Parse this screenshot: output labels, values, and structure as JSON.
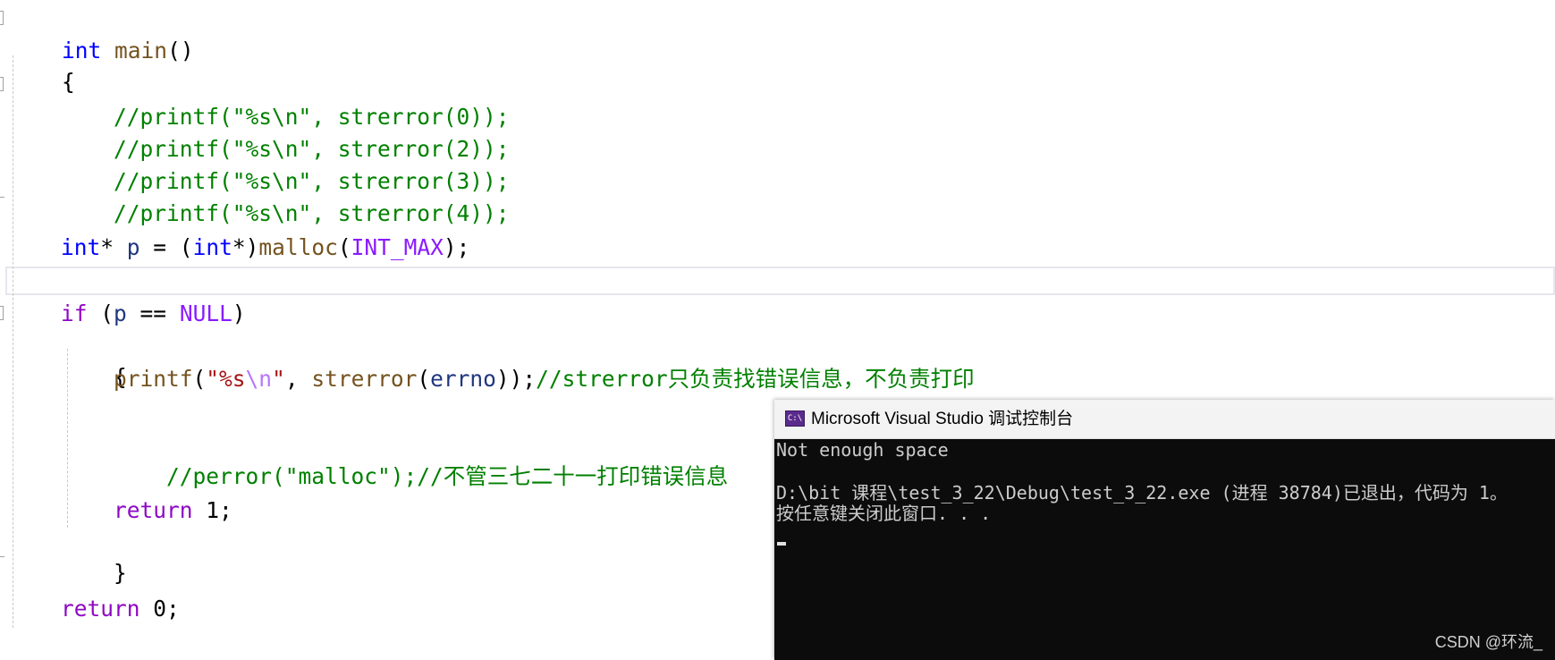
{
  "editor": {
    "lines": {
      "l1": {
        "kw_int": "int",
        "fn": "main",
        "paren": "()"
      },
      "l2": {
        "brace": "{"
      },
      "l3": {
        "comment": "//printf(\"%s\\n\", strerror(0));"
      },
      "l4": {
        "comment": "//printf(\"%s\\n\", strerror(2));"
      },
      "l5": {
        "comment": "//printf(\"%s\\n\", strerror(3));"
      },
      "l6": {
        "comment": "//printf(\"%s\\n\", strerror(4));"
      },
      "l8": {
        "int1": "int",
        "star1": "* ",
        "p": "p",
        "eq": " = (",
        "int2": "int",
        "star2": "*)",
        "malloc": "malloc",
        "open": "(",
        "intmax": "INT_MAX",
        "close": ");"
      },
      "l10": {
        "if": "if",
        "open": " (",
        "p": "p",
        "eq": " == ",
        "null": "NULL",
        "close": ")"
      },
      "l11": {
        "brace": "{"
      },
      "l12": {
        "printf": "printf",
        "open": "(",
        "str1": "\"%s",
        "esc": "\\n",
        "str2": "\"",
        "comma": ", ",
        "strerror": "strerror",
        "open2": "(",
        "errno": "errno",
        "close": "));",
        "comment": "//strerror只负责找错误信息，不负责打印"
      },
      "l14": {
        "comment": "//perror(\"malloc\");//不管三七二十一打印错误信息"
      },
      "l16": {
        "ret": "return",
        "val": " 1;"
      },
      "l17": {
        "brace": "}"
      },
      "l19": {
        "ret": "return",
        "val": " 0;"
      },
      "l20": {
        "brace": "}"
      }
    }
  },
  "console": {
    "icon_label": "C:\\",
    "title": "Microsoft Visual Studio 调试控制台",
    "output": [
      "Not enough space",
      "",
      "D:\\bit 课程\\test_3_22\\Debug\\test_3_22.exe (进程 38784)已退出，代码为 1。",
      "按任意键关闭此窗口. . ."
    ]
  },
  "watermark": "CSDN @环流_"
}
